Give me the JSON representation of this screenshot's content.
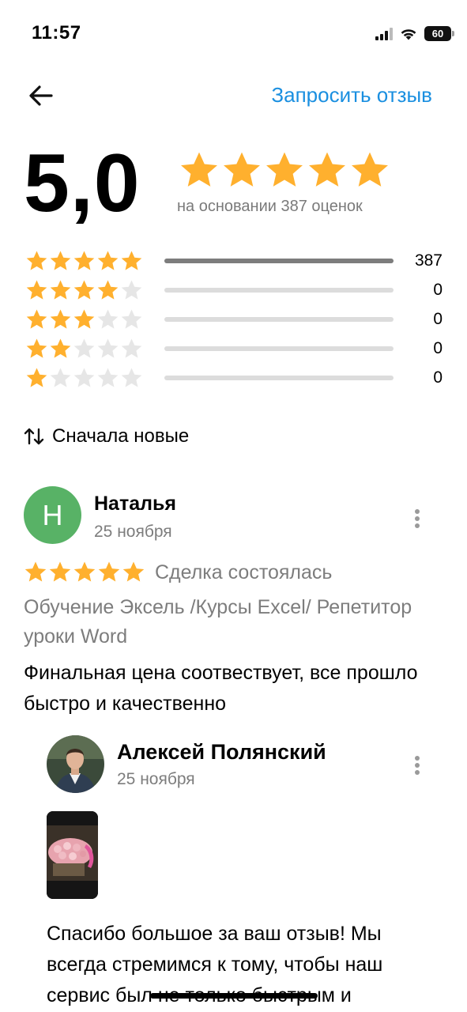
{
  "status_bar": {
    "time": "11:57",
    "battery": "60",
    "icons": [
      "signal-icon",
      "wifi-icon",
      "battery-icon"
    ]
  },
  "nav": {
    "back_icon": "arrow-left-icon",
    "request_review": "Запросить отзыв"
  },
  "summary": {
    "rating": "5,0",
    "stars": 5,
    "caption": "на основании 387 оценок"
  },
  "distribution": [
    {
      "stars": 5,
      "count": "387",
      "fraction": 1.0
    },
    {
      "stars": 4,
      "count": "0",
      "fraction": 0
    },
    {
      "stars": 3,
      "count": "0",
      "fraction": 0
    },
    {
      "stars": 2,
      "count": "0",
      "fraction": 0
    },
    {
      "stars": 1,
      "count": "0",
      "fraction": 0
    }
  ],
  "sort": {
    "icon": "sort-arrows-icon",
    "label": "Сначала новые"
  },
  "review": {
    "avatar_letter": "H",
    "author": "Наталья",
    "date": "25 ноября",
    "stars": 5,
    "deal_status": "Сделка состоялась",
    "service": "Обучение Эксель /Курсы Excel/ Репетитор уроки Word",
    "text": "Финальная цена соотвествует, все прошло быстро и качественно"
  },
  "reply": {
    "author": "Алексей Полянский",
    "date": "25 ноября",
    "text": "Спасибо большое за ваш отзыв! Мы всегда стремимся к тому, чтобы наш сервис был не только быстрым и"
  },
  "colors": {
    "star_filled": "#FFB02E",
    "star_empty": "#E6E6E6",
    "link": "#1A8FE0",
    "avatar_bg": "#58B266",
    "bar_fill": "#7D7D7D",
    "bar_track": "#DCDCDC",
    "muted_text": "#7D7D7D"
  }
}
